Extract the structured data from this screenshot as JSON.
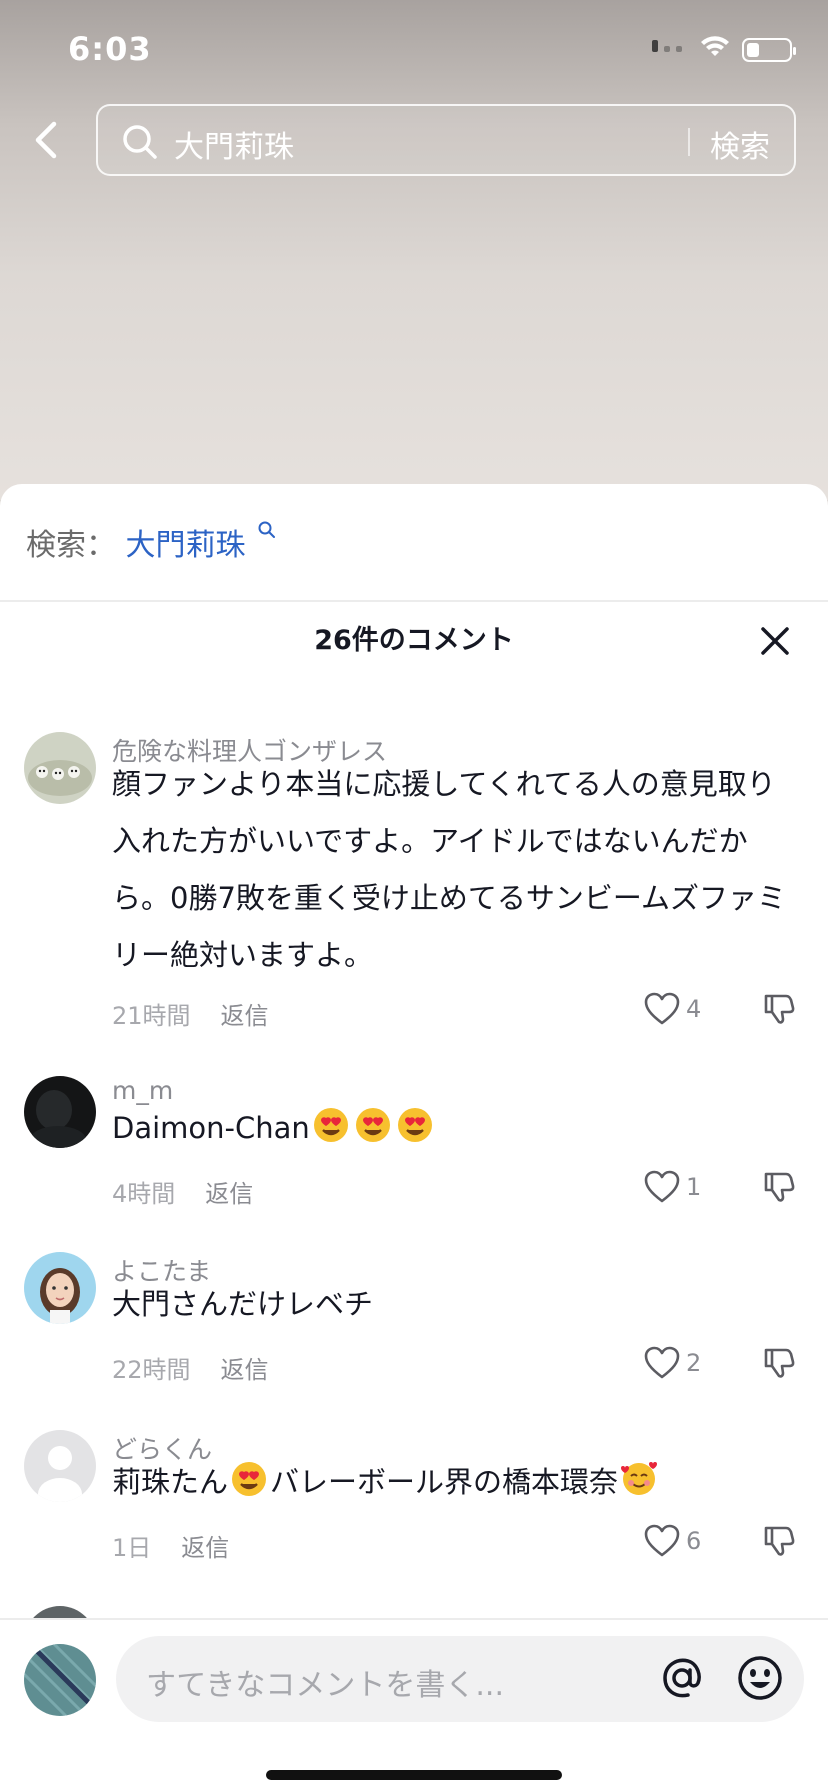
{
  "status_bar": {
    "time": "6:03"
  },
  "search": {
    "query": "大門莉珠",
    "button_label": "検索"
  },
  "related": {
    "label": "検索：",
    "term": "大門莉珠"
  },
  "comments_header": {
    "count_label": "26件のコメント"
  },
  "comments": [
    {
      "user": "危険な料理人ゴンザレス",
      "text": "顔ファンより本当に応援してくれてる人の意見取り入れた方がいいですよ。アイドルではないんだから。0勝7敗を重く受け止めてるサンビームズファミリー絶対いますよ。",
      "time": "21時間",
      "reply": "返信",
      "likes": "4"
    },
    {
      "user": "m_m",
      "text": "Daimon-Chan",
      "time": "4時間",
      "reply": "返信",
      "likes": "1"
    },
    {
      "user": "よこたま",
      "text": "大門さんだけレベチ",
      "time": "22時間",
      "reply": "返信",
      "likes": "2"
    },
    {
      "user": "どらくん",
      "text_before": "莉珠たん",
      "text_after": "バレーボール界の橋本環奈",
      "time": "1日",
      "reply": "返信",
      "likes": "6"
    }
  ],
  "composer": {
    "placeholder": "すてきなコメントを書く..."
  },
  "colors": {
    "link": "#2c63c5",
    "muted": "#8a8b91",
    "text": "#161823"
  }
}
